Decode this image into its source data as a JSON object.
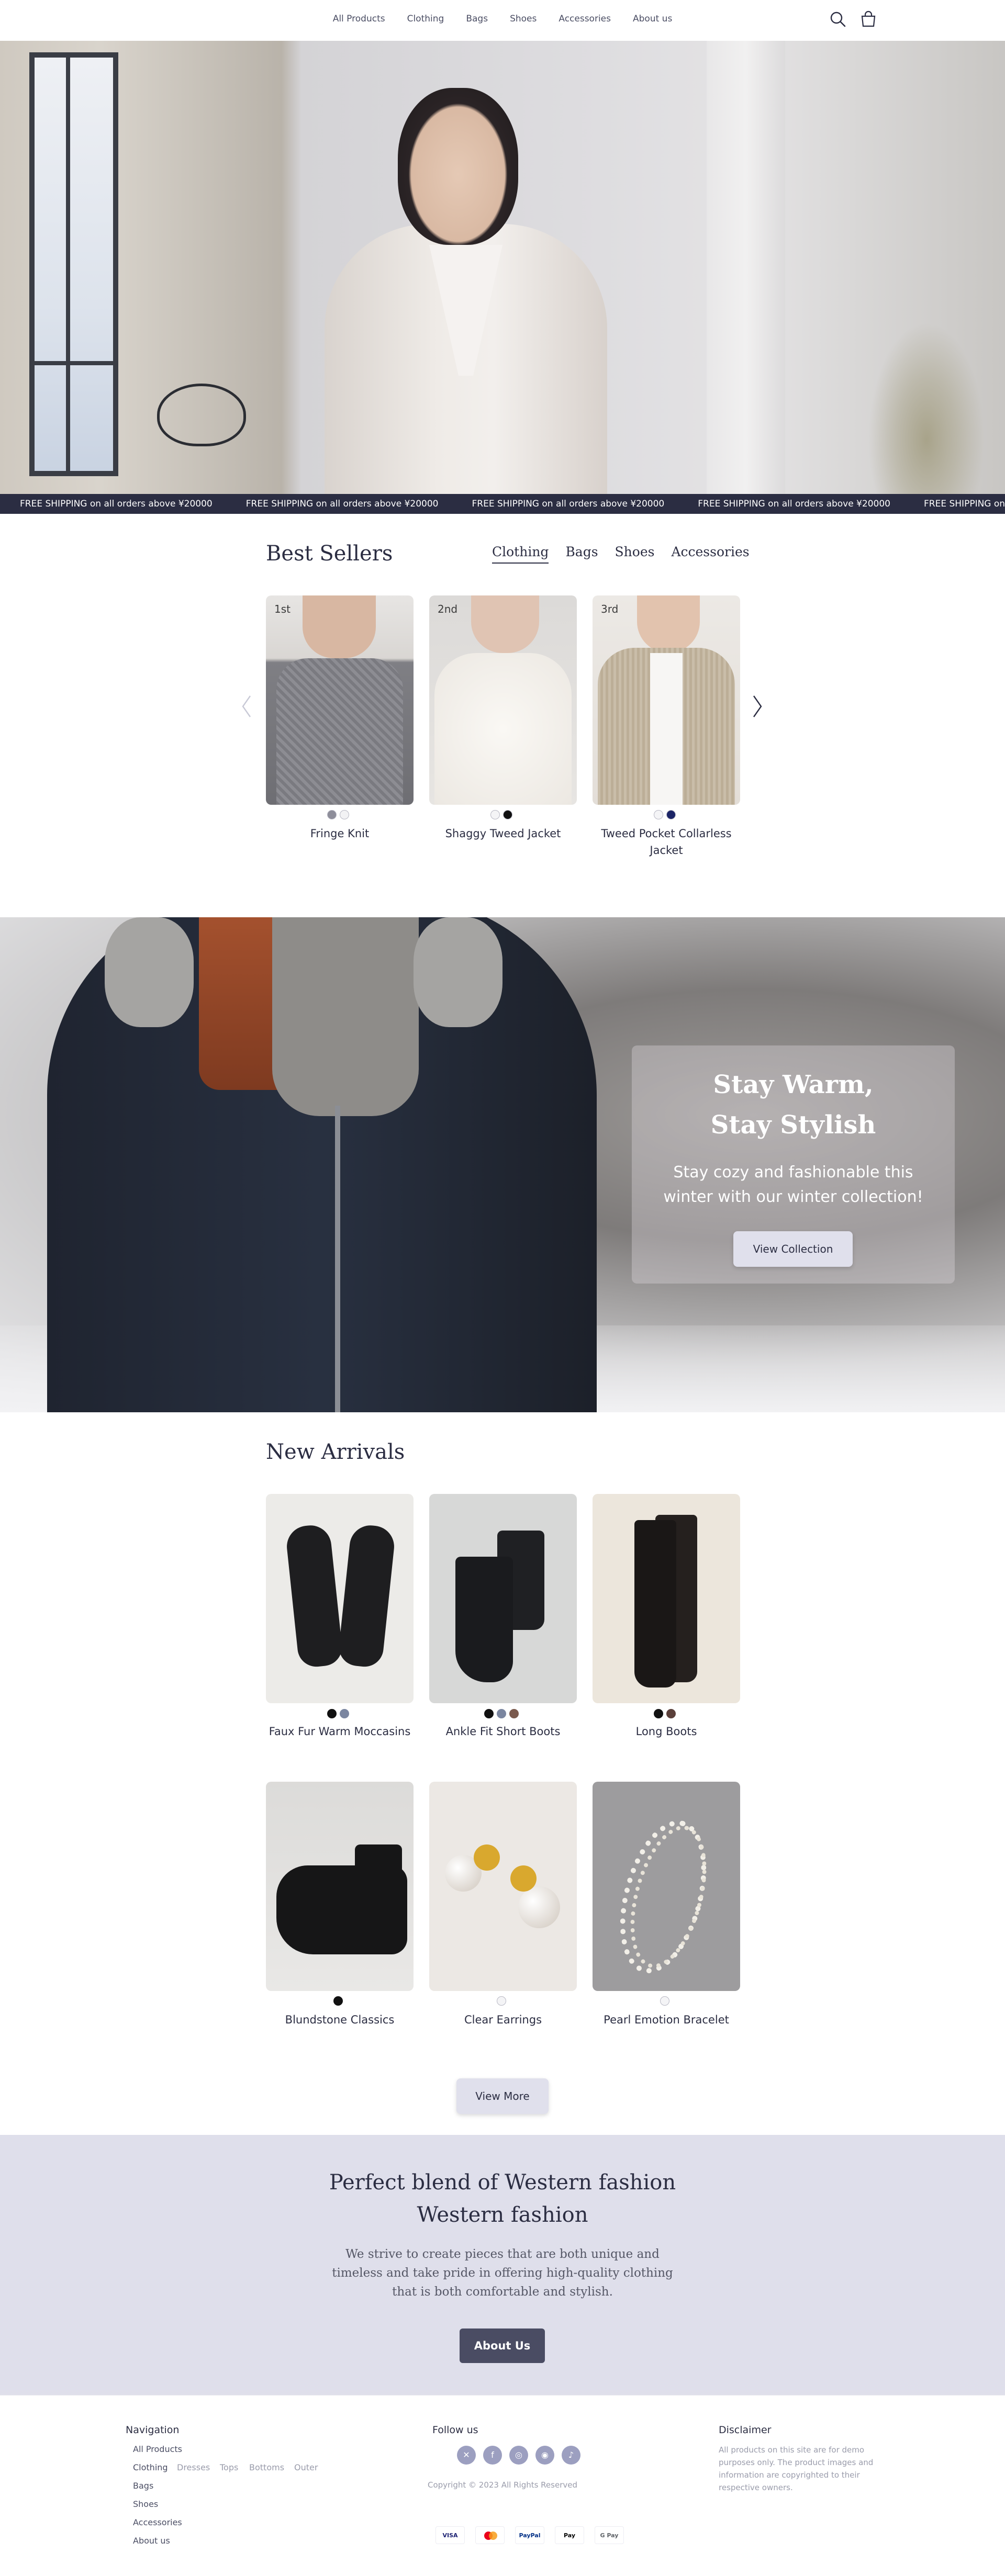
{
  "header": {
    "nav": [
      "All Products",
      "Clothing",
      "Bags",
      "Shoes",
      "Accessories",
      "About us"
    ],
    "icons": [
      "search-icon",
      "cart-icon"
    ]
  },
  "marquee": {
    "text": "FREE SHIPPING on all orders above ¥20000"
  },
  "best_sellers": {
    "title": "Best Sellers",
    "tabs": [
      "Clothing",
      "Bags",
      "Shoes",
      "Accessories"
    ],
    "active_tab": "Clothing",
    "items": [
      {
        "rank": "1st",
        "name": "Fringe Knit",
        "colors": [
          "#8e8e9a",
          "#f2f2f4"
        ]
      },
      {
        "rank": "2nd",
        "name": "Shaggy Tweed Jacket",
        "colors": [
          "#f4f4f6",
          "#111111"
        ]
      },
      {
        "rank": "3rd",
        "name": "Tweed Pocket Collarless Jacket",
        "colors": [
          "#f4f4f6",
          "#1b2466"
        ]
      }
    ]
  },
  "winter_banner": {
    "title_line1": "Stay Warm,",
    "title_line2": "Stay Stylish",
    "text": "Stay cozy and fashionable this winter with our winter collection!",
    "button": "View Collection"
  },
  "new_arrivals": {
    "title": "New Arrivals",
    "items": [
      {
        "name": "Faux Fur Warm Moccasins",
        "colors": [
          "#111111",
          "#7b86a0"
        ]
      },
      {
        "name": "Ankle Fit Short Boots",
        "colors": [
          "#111111",
          "#7b86a0",
          "#7a5a4e"
        ]
      },
      {
        "name": "Long Boots",
        "colors": [
          "#111111",
          "#5a3f3a"
        ]
      },
      {
        "name": "Blundstone Classics",
        "colors": [
          "#111111"
        ]
      },
      {
        "name": "Clear Earrings",
        "colors": [
          "#f4f4f6"
        ]
      },
      {
        "name": "Pearl Emotion Bracelet",
        "colors": [
          "#f4f4f6"
        ]
      }
    ],
    "view_more": "View More"
  },
  "blend": {
    "title_line1": "Perfect blend of Western fashion",
    "title_line2": "Western fashion",
    "text": "We strive to create pieces that are both unique and timeless and take pride in offering high-quality clothing that is both comfortable and stylish.",
    "button": "About Us"
  },
  "footer": {
    "navigation_title": "Navigation",
    "nav_links": [
      "All Products",
      "Clothing",
      "Bags",
      "Shoes",
      "Accessories",
      "About us"
    ],
    "clothing_sub": [
      "Dresses",
      "Tops",
      "Bottoms",
      "Outer"
    ],
    "follow_title": "Follow us",
    "social": [
      "x-icon",
      "facebook-icon",
      "instagram-icon",
      "pinterest-icon",
      "tiktok-icon"
    ],
    "copyright": "Copyright © 2023 All Rights Reserved",
    "payments": [
      "VISA",
      "MC",
      "PayPal",
      "Pay",
      "G Pay"
    ],
    "disclaimer_title": "Disclaimer",
    "disclaimer_text": "All products on this site are for demo purposes only. The product images and information are copyrighted to their respective owners."
  }
}
